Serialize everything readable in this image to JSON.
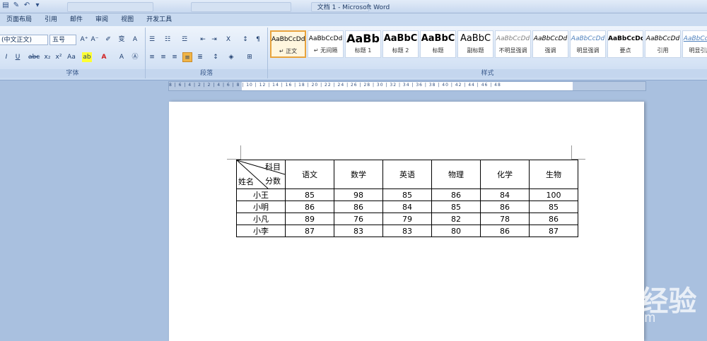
{
  "window": {
    "title": "文档 1 - Microsoft Word"
  },
  "tabs": [
    "页面布局",
    "引用",
    "邮件",
    "审阅",
    "视图",
    "开发工具"
  ],
  "font_group": {
    "font_name": "(中文正文)",
    "font_size": "五号",
    "label": "字体"
  },
  "paragraph_group": {
    "label": "段落"
  },
  "styles_group": {
    "label": "样式",
    "items": [
      {
        "preview": "AaBbCcDd",
        "name": "↵ 正文"
      },
      {
        "preview": "AaBbCcDd",
        "name": "↵ 无间隔"
      },
      {
        "preview": "AaBb",
        "name": "标题 1"
      },
      {
        "preview": "AaBbC",
        "name": "标题 2"
      },
      {
        "preview": "AaBbC",
        "name": "标题"
      },
      {
        "preview": "AaBbC",
        "name": "副标题"
      },
      {
        "preview": "AaBbCcDd",
        "name": "不明显强调"
      },
      {
        "preview": "AaBbCcDd",
        "name": "强调"
      },
      {
        "preview": "AaBbCcDd",
        "name": "明显强调"
      },
      {
        "preview": "AaBbCcDd",
        "name": "要点"
      },
      {
        "preview": "AaBbCcDd",
        "name": "引用"
      },
      {
        "preview": "AaBbCcDd",
        "name": "明显引用"
      }
    ]
  },
  "ruler": {
    "numbers": "8 | 6 | 4 | 2 | 2 | 4 | 6 | 8 | 10 | 12 | 14 | 16 | 18 | 20 | 22 | 24 | 26 | 28 | 30 | 32 | 34 | 36 | 38 | 40 | 42 | 44 | 46 | 48"
  },
  "table": {
    "corner": {
      "top": "科目",
      "middle": "分数",
      "bottom": "姓名"
    },
    "subjects": [
      "语文",
      "数学",
      "英语",
      "物理",
      "化学",
      "生物"
    ],
    "rows": [
      {
        "name": "小王",
        "scores": [
          "85",
          "98",
          "85",
          "86",
          "84",
          "100"
        ]
      },
      {
        "name": "小明",
        "scores": [
          "86",
          "86",
          "84",
          "85",
          "86",
          "85"
        ]
      },
      {
        "name": "小凡",
        "scores": [
          "89",
          "76",
          "79",
          "82",
          "78",
          "86"
        ]
      },
      {
        "name": "小李",
        "scores": [
          "87",
          "83",
          "83",
          "80",
          "86",
          "87"
        ]
      }
    ]
  },
  "watermark": {
    "logo": "Bai du 经验",
    "url": "jingyan.baidu.com"
  }
}
